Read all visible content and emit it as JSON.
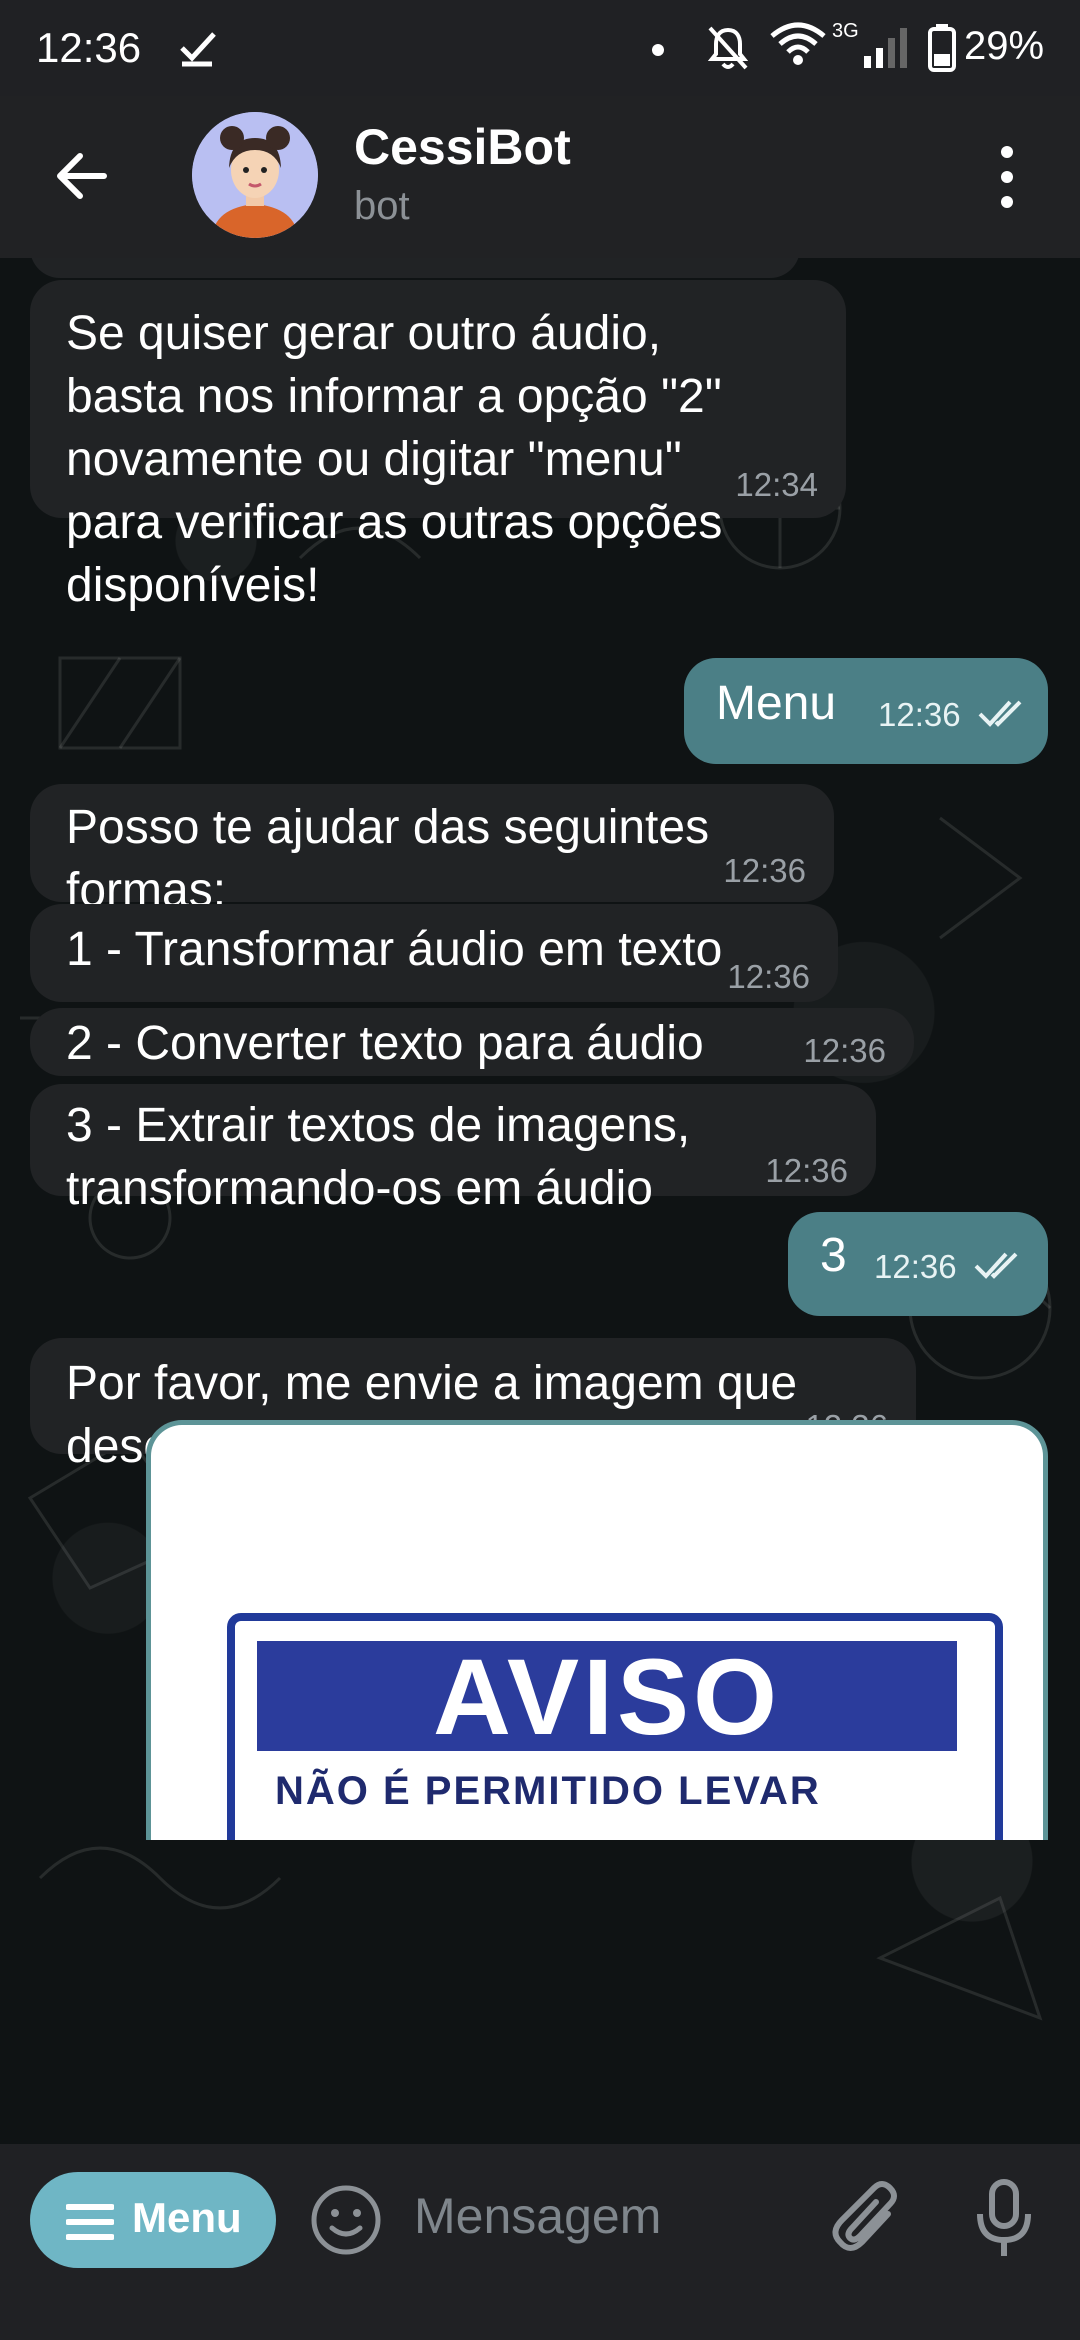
{
  "status_bar": {
    "time": "12:36",
    "network": "3G",
    "battery": "29%"
  },
  "header": {
    "title": "CessiBot",
    "subtitle": "bot"
  },
  "messages": [
    {
      "dir": "in",
      "text": "Se quiser gerar outro áudio,\nbasta nos informar a opção \"2\"\nnovamente ou digitar \"menu\"\npara verificar as outras opções\ndisponíveis!",
      "time": "12:34"
    },
    {
      "dir": "out",
      "text": "Menu",
      "time": "12:36",
      "read": true
    },
    {
      "dir": "in",
      "text": "Posso te ajudar das seguintes\nformas:",
      "time": "12:36"
    },
    {
      "dir": "in",
      "text": "1 - Transformar áudio em texto",
      "time": "12:36"
    },
    {
      "dir": "in",
      "text": "2 - Converter texto para áudio",
      "time": "12:36"
    },
    {
      "dir": "in",
      "text": "3 - Extrair textos de imagens,\ntransformando-os em áudio",
      "time": "12:36"
    },
    {
      "dir": "out",
      "text": "3",
      "time": "12:36",
      "read": true
    },
    {
      "dir": "in",
      "text": "Por favor, me envie a imagem que\ndeseja extrair o texto:",
      "time": "12:36"
    }
  ],
  "image_message": {
    "sign_title": "AVISO",
    "sign_subtitle": "NÃO É PERMITIDO LEVAR"
  },
  "input_bar": {
    "menu_label": "Menu",
    "placeholder": "Mensagem"
  },
  "colors": {
    "outgoing_bubble": "#4b7f86",
    "incoming_bubble": "#212325",
    "menu_button": "#6fb6c5",
    "header": "#212224"
  },
  "icons": [
    "check-icon",
    "mute-icon",
    "wifi-icon",
    "signal-icon",
    "battery-icon",
    "back-arrow-icon",
    "more-vertical-icon",
    "double-check-icon",
    "hamburger-icon",
    "emoji-icon",
    "attach-icon",
    "mic-icon"
  ]
}
